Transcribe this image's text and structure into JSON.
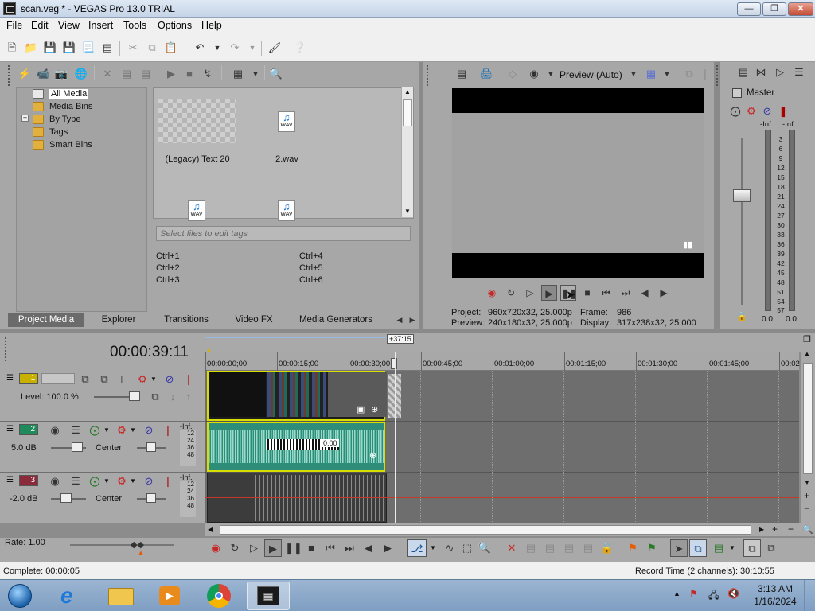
{
  "window": {
    "title": "scan.veg * - VEGAS Pro 13.0 TRIAL",
    "minimize_icon": "minimize-icon",
    "maximize_icon": "restore-icon",
    "close_icon": "close-icon"
  },
  "menu": [
    "File",
    "Edit",
    "View",
    "Insert",
    "Tools",
    "Options",
    "Help"
  ],
  "project_media": {
    "tree": [
      "All Media",
      "Media Bins",
      "By Type",
      "Tags",
      "Smart Bins"
    ],
    "expander": "+",
    "items": [
      {
        "label": "(Legacy) Text 20"
      },
      {
        "label": "2.wav",
        "badge": "WAV"
      },
      {
        "label": "",
        "badge": "WAV"
      },
      {
        "label": "",
        "badge": "WAV"
      }
    ],
    "tag_placeholder": "Select files to edit tags",
    "shortcuts": [
      "Ctrl+1",
      "Ctrl+4",
      "Ctrl+2",
      "Ctrl+5",
      "Ctrl+3",
      "Ctrl+6"
    ],
    "tabs": [
      "Project Media",
      "Explorer",
      "Transitions",
      "Video FX",
      "Media Generators"
    ]
  },
  "preview": {
    "mode": "Preview (Auto)",
    "project_label": "Project:",
    "project_value": "960x720x32, 25.000p",
    "frame_label": "Frame:",
    "frame_value": "986",
    "preview_label": "Preview:",
    "preview_value": "240x180x32, 25.000p",
    "display_label": "Display:",
    "display_value": "317x238x32, 25.000"
  },
  "master": {
    "title": "Master",
    "left_inf": "-Inf.",
    "right_inf": "-Inf.",
    "scale": [
      "3",
      "6",
      "9",
      "12",
      "15",
      "18",
      "21",
      "24",
      "27",
      "30",
      "33",
      "36",
      "39",
      "42",
      "45",
      "48",
      "51",
      "54",
      "57"
    ],
    "left_value": "0.0",
    "right_value": "0.0"
  },
  "timeline": {
    "timecode": "00:00:39:11",
    "cursor_badge": "+37:15",
    "ruler": [
      "00:00:00;00",
      "00:00:15;00",
      "00:00:30;00",
      "00:00:45;00",
      "00:01:00;00",
      "00:01:15;00",
      "00:01:30;00",
      "00:01:45;00",
      "00:02"
    ],
    "tracks": [
      {
        "num": "1",
        "level": "Level: 100.0 %"
      },
      {
        "num": "2",
        "volume": "5.0 dB",
        "pan": "Center",
        "inf": "-Inf.",
        "scale": [
          "12",
          "24",
          "36",
          "48"
        ]
      },
      {
        "num": "3",
        "volume": "-2.0 dB",
        "pan": "Center",
        "inf": "-Inf.",
        "scale": [
          "12",
          "24",
          "36",
          "48"
        ]
      }
    ],
    "audio_clip_text": "0:00"
  },
  "transport": {
    "rate": "Rate: 1.00"
  },
  "status": {
    "left": "Complete: 00:00:05",
    "right": "Record Time (2 channels): 30:10:55"
  },
  "taskbar": {
    "time": "3:13 AM",
    "date": "1/16/2024",
    "apps": [
      "start-orb",
      "internet-explorer-icon",
      "file-explorer-icon",
      "media-player-icon",
      "chrome-icon",
      "vegas-icon"
    ]
  }
}
